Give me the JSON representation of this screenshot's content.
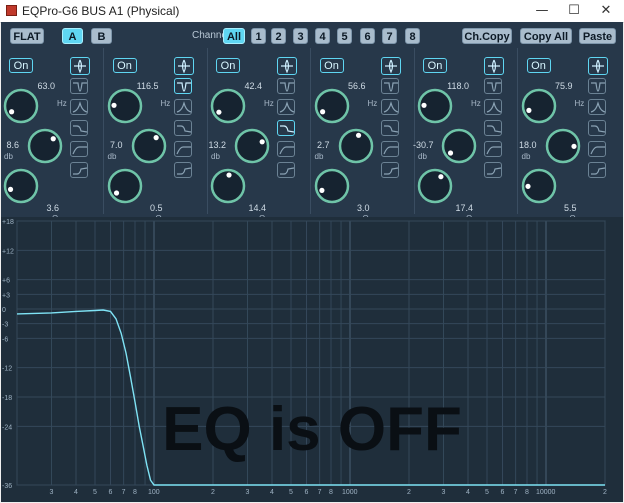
{
  "window": {
    "title": "EQPro-G6 BUS A1 (Physical)",
    "minimize_glyph": "—",
    "maximize_glyph": "☐",
    "close_glyph": "✕"
  },
  "toolbar": {
    "flat": "FLAT",
    "a": "A",
    "b": "B",
    "channel_label": "Channel:",
    "channels": [
      "All",
      "1",
      "2",
      "3",
      "4",
      "5",
      "6",
      "7",
      "8"
    ],
    "ch_copy": "Ch.Copy",
    "copy_all": "Copy All",
    "paste": "Paste"
  },
  "bands": [
    {
      "on": "On",
      "freq": "63.0",
      "gain": "8.6",
      "q": "3.6",
      "freq_unit": "Hz",
      "gain_unit": "db",
      "q_unit": "Q",
      "freq_level": 0.05,
      "gain_level": 0.68,
      "q_level": 0.1,
      "active_filter": "bell"
    },
    {
      "on": "On",
      "freq": "116.5",
      "gain": "7.0",
      "q": "0.5",
      "freq_unit": "Hz",
      "gain_unit": "db",
      "q_unit": "Q",
      "freq_level": 0.18,
      "gain_level": 0.65,
      "q_level": 0.02,
      "active_filter": "notch"
    },
    {
      "on": "On",
      "freq": "42.4",
      "gain": "13.2",
      "q": "14.4",
      "freq_unit": "Hz",
      "gain_unit": "db",
      "q_unit": "Q",
      "freq_level": 0.04,
      "gain_level": 0.75,
      "q_level": 0.52,
      "active_filter": "high-shelf"
    },
    {
      "on": "On",
      "freq": "56.6",
      "gain": "2.7",
      "q": "3.0",
      "freq_unit": "Hz",
      "gain_unit": "db",
      "q_unit": "Q",
      "freq_level": 0.05,
      "gain_level": 0.55,
      "q_level": 0.08,
      "active_filter": "bell"
    },
    {
      "on": "On",
      "freq": "118.0",
      "gain": "-30.7",
      "q": "17.4",
      "freq_unit": "Hz",
      "gain_unit": "db",
      "q_unit": "Q",
      "freq_level": 0.18,
      "gain_level": 0.02,
      "q_level": 0.62,
      "active_filter": "bell"
    },
    {
      "on": "On",
      "freq": "75.9",
      "gain": "18.0",
      "q": "5.5",
      "freq_unit": "Hz",
      "gain_unit": "db",
      "q_unit": "Q",
      "freq_level": 0.08,
      "gain_level": 0.84,
      "q_level": 0.16,
      "active_filter": "bell"
    }
  ],
  "filter_icons": [
    "bell",
    "notch",
    "band-pass",
    "high-shelf",
    "low-cut",
    "low-shelf"
  ],
  "graph": {
    "y_ticks": [
      "+18",
      "+12",
      "+6",
      "+3",
      "0",
      "-3",
      "-6",
      "-12",
      "-18",
      "-24",
      "-36"
    ],
    "x_ticks": [
      "3",
      "4",
      "5",
      "6",
      "7",
      "8",
      "100",
      "2",
      "3",
      "4",
      "5",
      "6",
      "7",
      "8",
      "1000",
      "2",
      "3",
      "4",
      "5",
      "6",
      "7",
      "8",
      "10000",
      "2"
    ],
    "overlay": "EQ is OFF"
  },
  "colors": {
    "accent": "#5fd6f2",
    "knob_ring": "#6fc4a8",
    "background": "#27384a",
    "graph_bg": "#1f2e3b"
  },
  "chart_data": {
    "type": "line",
    "series": [
      {
        "x": [
          20,
          30,
          40,
          50,
          55,
          60,
          64,
          68,
          72,
          76,
          80,
          84,
          88,
          92,
          96,
          100,
          20000
        ],
        "y": [
          -1,
          -0.8,
          -0.5,
          -0.3,
          -0.2,
          -0.5,
          -2,
          -5,
          -9,
          -14,
          -19,
          -24,
          -28,
          -32,
          -35,
          -36,
          -36
        ]
      }
    ],
    "ylim": [
      -36,
      18
    ]
  }
}
